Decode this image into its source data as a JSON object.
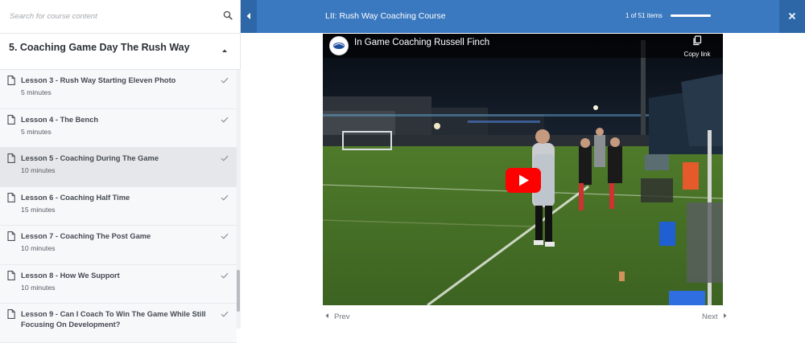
{
  "search": {
    "placeholder": "Search for course content"
  },
  "section": {
    "title": "5. Coaching Game Day The Rush Way"
  },
  "lessons": [
    {
      "title": "Lesson 3 - Rush Way Starting Eleven Photo",
      "duration": "5 minutes"
    },
    {
      "title": "Lesson 4 - The Bench",
      "duration": "5 minutes"
    },
    {
      "title": "Lesson 5 - Coaching During The Game",
      "duration": "10 minutes"
    },
    {
      "title": "Lesson 6 - Coaching Half Time",
      "duration": "15 minutes"
    },
    {
      "title": "Lesson 7 - Coaching The Post Game",
      "duration": "10 minutes"
    },
    {
      "title": "Lesson 8 - How We Support",
      "duration": "10 minutes"
    },
    {
      "title": "Lesson 9 - Can I Coach To Win The Game While Still Focusing On Development?",
      "duration": ""
    }
  ],
  "header": {
    "course_title": "LII: Rush Way Coaching Course",
    "item_count": "1 of 51 items",
    "progress_fraction": 1.0
  },
  "video": {
    "title": "In Game Coaching Russell Finch",
    "copy_link": "Copy link"
  },
  "nav": {
    "prev": "Prev",
    "next": "Next"
  },
  "colors": {
    "accent": "#3a78bf",
    "accent_dark": "#2e67a8",
    "play": "#ff0000"
  }
}
